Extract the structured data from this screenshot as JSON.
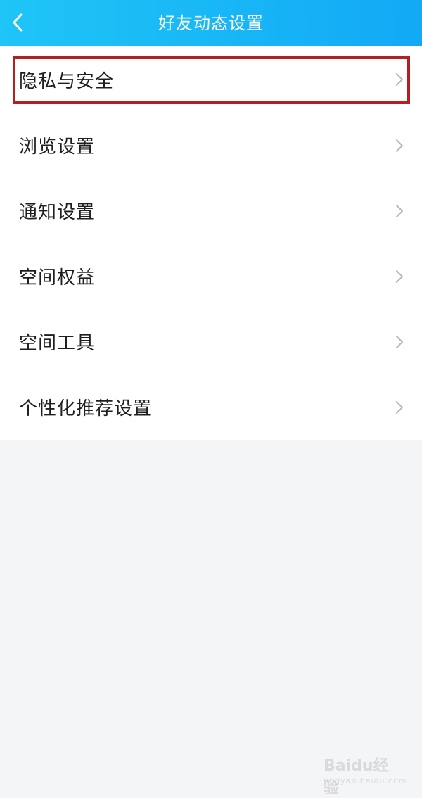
{
  "header": {
    "title": "好友动态设置",
    "back_icon": "chevron-left-icon"
  },
  "settings": {
    "items": [
      {
        "label": "隐私与安全",
        "highlighted": true
      },
      {
        "label": "浏览设置"
      },
      {
        "label": "通知设置"
      },
      {
        "label": "空间权益"
      },
      {
        "label": "空间工具"
      },
      {
        "label": "个性化推荐设置"
      }
    ]
  },
  "watermark": {
    "brand": "Baidu经验",
    "url": "jingyan.baidu.com"
  },
  "colors": {
    "header_gradient_start": "#1fc5f7",
    "header_gradient_end": "#12a9f5",
    "highlight_border": "#b41f1f",
    "page_background": "#f4f5f7",
    "list_background": "#ffffff"
  }
}
